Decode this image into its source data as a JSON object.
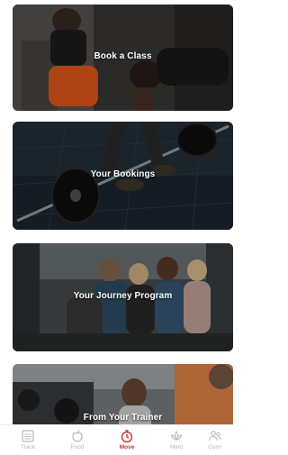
{
  "cards": [
    {
      "id": "book",
      "label": "Book a Class"
    },
    {
      "id": "bookings",
      "label": "Your Bookings"
    },
    {
      "id": "journey",
      "label": "Your Journey Program"
    },
    {
      "id": "trainer",
      "label": "From Your Trainer"
    }
  ],
  "nav": {
    "items": [
      {
        "label": "Track",
        "icon": "calendar-list-icon",
        "active": false
      },
      {
        "label": "Food",
        "icon": "apple-icon",
        "active": false
      },
      {
        "label": "Move",
        "icon": "stopwatch-icon",
        "active": true
      },
      {
        "label": "Mind",
        "icon": "lotus-icon",
        "active": false
      },
      {
        "label": "Conn",
        "icon": "people-icon",
        "active": false
      }
    ]
  },
  "colors": {
    "accent": "#d32f2f",
    "nav_inactive": "#b8b8b8"
  }
}
